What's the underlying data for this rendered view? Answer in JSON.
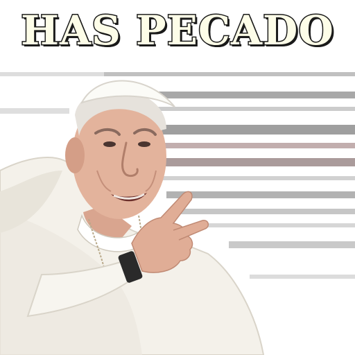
{
  "caption": {
    "text": "HAS PECADO",
    "fill_color": "#fdfde8",
    "outline_color": "#1a1a1a"
  },
  "photo": {
    "subject": "person-in-white-cassock-pointing",
    "background_stripes": "#a8a8a8"
  }
}
